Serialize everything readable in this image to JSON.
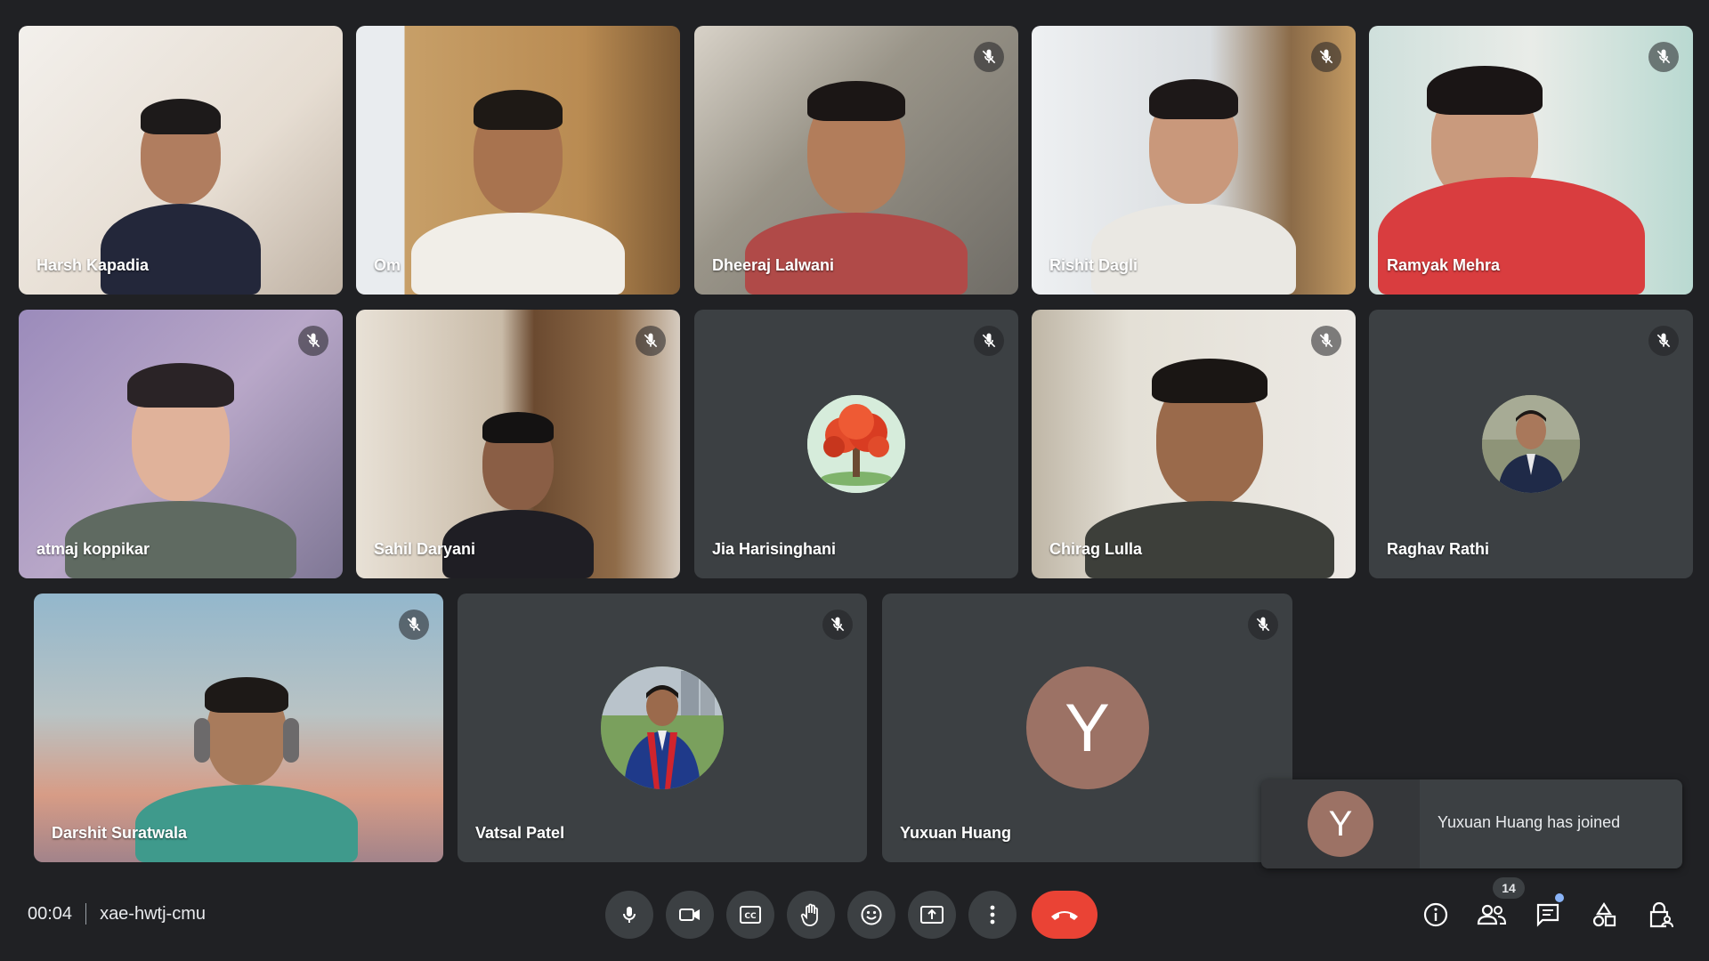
{
  "meeting": {
    "time": "00:04",
    "code": "xae-hwtj-cmu"
  },
  "participants": [
    {
      "name": "Harsh Kapadia",
      "muted": false
    },
    {
      "name": "Om",
      "muted": false
    },
    {
      "name": "Dheeraj Lalwani",
      "muted": true
    },
    {
      "name": "Rishit Dagli",
      "muted": true
    },
    {
      "name": "Ramyak Mehra",
      "muted": true
    },
    {
      "name": "atmaj koppikar",
      "muted": true
    },
    {
      "name": "Sahil Daryani",
      "muted": true
    },
    {
      "name": "Jia Harisinghani",
      "muted": true
    },
    {
      "name": "Chirag Lulla",
      "muted": true
    },
    {
      "name": "Raghav Rathi",
      "muted": true
    },
    {
      "name": "Darshit Suratwala",
      "muted": true
    },
    {
      "name": "Vatsal Patel",
      "muted": true
    },
    {
      "name": "Yuxuan Huang",
      "muted": true,
      "initial": "Y"
    }
  ],
  "toast": {
    "initial": "Y",
    "message": "Yuxuan Huang has joined"
  },
  "participant_count": "14",
  "controls": [
    {
      "id": "mic",
      "icon": "microphone-icon"
    },
    {
      "id": "camera",
      "icon": "camera-icon"
    },
    {
      "id": "captions",
      "icon": "captions-icon"
    },
    {
      "id": "raise-hand",
      "icon": "hand-icon"
    },
    {
      "id": "reactions",
      "icon": "emoji-icon"
    },
    {
      "id": "present",
      "icon": "present-screen-icon"
    },
    {
      "id": "more",
      "icon": "more-vert-icon"
    },
    {
      "id": "leave",
      "icon": "end-call-icon"
    }
  ],
  "right_controls": [
    {
      "id": "info",
      "icon": "info-icon"
    },
    {
      "id": "people",
      "icon": "people-icon"
    },
    {
      "id": "chat",
      "icon": "chat-icon"
    },
    {
      "id": "activities",
      "icon": "activities-icon"
    },
    {
      "id": "host-controls",
      "icon": "lock-person-icon"
    }
  ],
  "colors": {
    "background": "#202124",
    "tile": "#3c4043",
    "end_call": "#ea4335",
    "avatar_letter_bg": "#9c7265",
    "notification_dot": "#8ab4f8"
  }
}
